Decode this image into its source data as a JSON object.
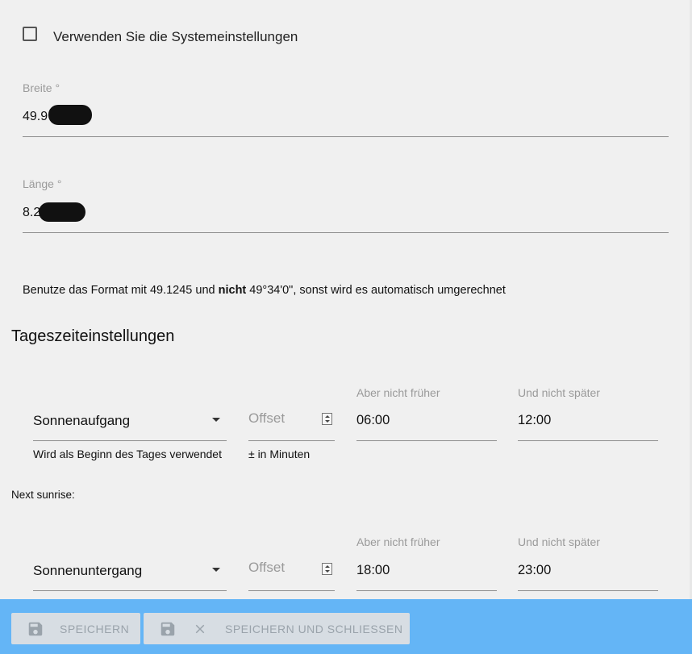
{
  "system_settings": {
    "label": "Verwenden Sie die Systemeinstellungen",
    "checked": false
  },
  "latitude": {
    "label": "Breite °",
    "value": "49.9"
  },
  "longitude": {
    "label": "Länge °",
    "value": "8.2"
  },
  "format_hint": {
    "part1": "Benutze das Format mit 49.1245 und ",
    "bold": "nicht",
    "part2": " 49°34'0\", sonst wird es automatisch umgerechnet"
  },
  "section_title": "Tageszeiteinstellungen",
  "sunrise": {
    "event": "Sonnenaufgang",
    "event_helper": "Wird als Beginn des Tages verwendet",
    "offset_placeholder": "Offset",
    "offset_helper": "± in Minuten",
    "not_before_label": "Aber nicht früher",
    "not_before": "06:00",
    "not_after_label": "Und nicht später",
    "not_after": "12:00",
    "next_label": "Next sunrise:"
  },
  "sunset": {
    "event": "Sonnenuntergang",
    "offset_placeholder": "Offset",
    "not_before_label": "Aber nicht früher",
    "not_before": "18:00",
    "not_after_label": "Und nicht später",
    "not_after": "23:00"
  },
  "footer": {
    "save_label": "SPEICHERN",
    "save_close_label": "SPEICHERN UND SCHLIESSEN",
    "icons": [
      "save-icon",
      "close-icon"
    ],
    "bar_color": "#64b5f6"
  }
}
